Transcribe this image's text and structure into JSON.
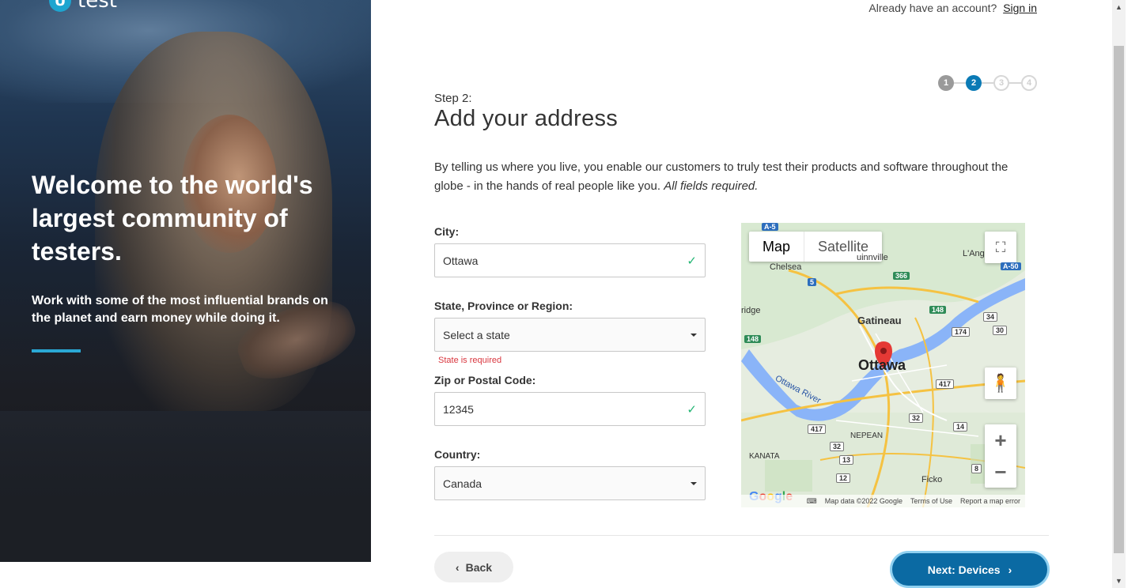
{
  "brand": {
    "logo_glyph": "U",
    "logo_text": "test"
  },
  "hero": {
    "headline": "Welcome to the world's largest community of testers.",
    "subtext": "Work with some of the most influential brands on the planet and earn money while doing it.",
    "accent_color": "#2aa8d5"
  },
  "header": {
    "account_prompt": "Already have an account?",
    "signin_label": "Sign in"
  },
  "stepper": {
    "steps": [
      "1",
      "2",
      "3",
      "4"
    ],
    "current": 2,
    "active_color": "#0a7ab5"
  },
  "page": {
    "step_label": "Step 2:",
    "title": "Add your address",
    "intro": "By telling us where you live, you enable our customers to truly test their products and software throughout the globe - in the hands of real people like you.",
    "intro_emphasis": "All fields required."
  },
  "form": {
    "city": {
      "label": "City:",
      "value": "Ottawa",
      "valid_icon": "checkmark-icon"
    },
    "state": {
      "label": "State, Province or Region:",
      "placeholder": "Select a state",
      "error": "State is required"
    },
    "zip": {
      "label": "Zip or Postal Code:",
      "value": "12345",
      "valid_icon": "checkmark-icon"
    },
    "country": {
      "label": "Country:",
      "value": "Canada"
    }
  },
  "map": {
    "type_map": "Map",
    "type_satellite": "Satellite",
    "labels": [
      "Chelsea",
      "Gatineau",
      "Ottawa",
      "NEPEAN",
      "KANATA",
      "Ficko",
      "L'Ang",
      "ridge",
      "uinnville",
      "Ottawa River"
    ],
    "shields": [
      "A-5",
      "5",
      "366",
      "148",
      "148",
      "34",
      "174",
      "30",
      "A-50",
      "417",
      "417",
      "32",
      "32",
      "13",
      "12",
      "8",
      "14"
    ],
    "footer": [
      "Map data ©2022 Google",
      "Terms of Use",
      "Report a map error"
    ],
    "google_logo": "Google"
  },
  "actions": {
    "back_label": "Back",
    "next_label": "Next: Devices",
    "next_color": "#0b6aa3"
  }
}
